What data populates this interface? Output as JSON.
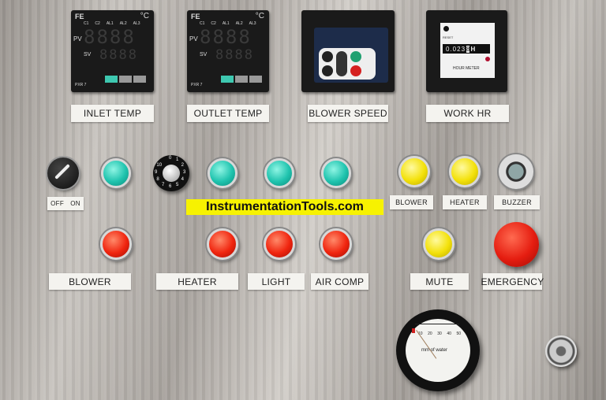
{
  "controllers": [
    {
      "brand": "FE",
      "unit": "°C",
      "indicators": [
        "C1",
        "C2",
        "AL1",
        "AL2",
        "AL3"
      ],
      "pv_label": "PV",
      "sv_label": "SV",
      "pv": "8888",
      "sv": "8888",
      "model": "PXR 7",
      "label": "INLET TEMP"
    },
    {
      "brand": "FE",
      "unit": "°C",
      "indicators": [
        "C1",
        "C2",
        "AL1",
        "AL2",
        "AL3"
      ],
      "pv_label": "PV",
      "sv_label": "SV",
      "pv": "8888",
      "sv": "8888",
      "model": "PXR 7",
      "label": "OUTLET TEMP"
    }
  ],
  "blower_speed": {
    "label": "BLOWER SPEED"
  },
  "hour_meter": {
    "reset": "RESET",
    "reading": "0.023",
    "last_digit": "8",
    "unit": "H",
    "caption": "HOUR METER",
    "label": "WORK HR"
  },
  "selector": {
    "off": "OFF",
    "on": "ON"
  },
  "dial": {
    "marks": [
      "0",
      "1",
      "2",
      "3",
      "4",
      "5",
      "6",
      "7",
      "8",
      "9",
      "10"
    ]
  },
  "watermark": "InstrumentationTools.com",
  "top_labels": {
    "blower": "BLOWER",
    "heater": "HEATER",
    "buzzer": "BUZZER"
  },
  "bottom_labels": {
    "blower": "BLOWER",
    "heater": "HEATER",
    "light": "LIGHT",
    "air_comp": "AIR COMP",
    "mute": "MUTE",
    "emergency": "EMERGENCY"
  },
  "gauge": {
    "ticks": [
      "10",
      "20",
      "30",
      "40",
      "50"
    ],
    "unit": "mm of water"
  },
  "colors": {
    "green": "#1fc3ae",
    "red": "#f0250f",
    "yellow": "#f3e10a",
    "banner": "#f7f200"
  }
}
